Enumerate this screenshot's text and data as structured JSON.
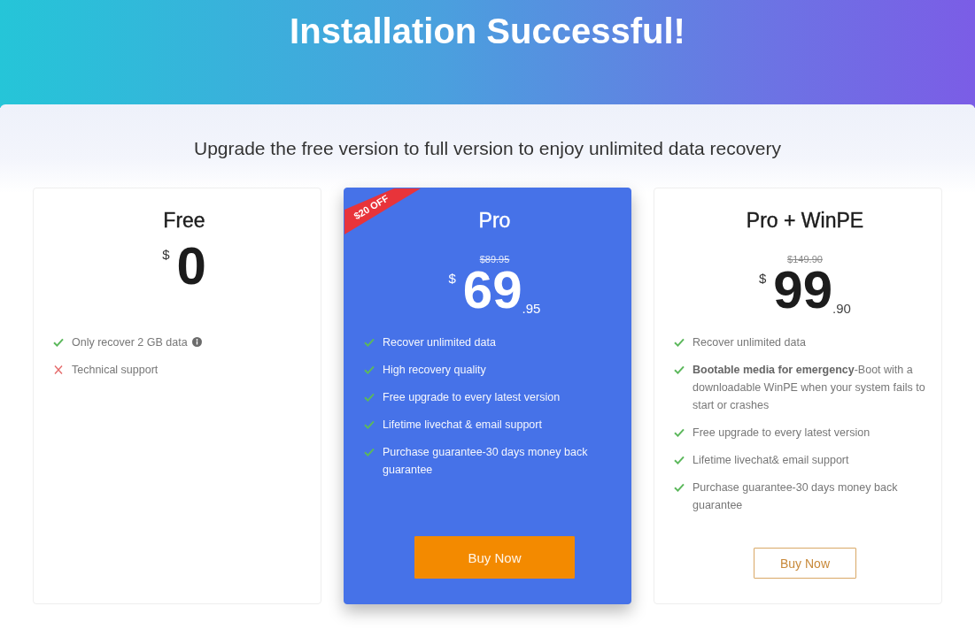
{
  "header": {
    "title": "Installation Successful!"
  },
  "subtitle": "Upgrade the free version to full version to enjoy unlimited data recovery",
  "plans": [
    {
      "name": "Free",
      "highlighted": false,
      "price": {
        "currency": "$",
        "whole": "0"
      },
      "features": [
        {
          "text": "Only recover 2 GB data",
          "included": true,
          "info": true
        },
        {
          "text": "Technical support",
          "included": false,
          "info": false
        }
      ]
    },
    {
      "name": "Pro",
      "highlighted": true,
      "badge": "$20 OFF",
      "old_price": "$89.95",
      "price": {
        "currency": "$",
        "whole": "69",
        "cents": ".95"
      },
      "features": [
        {
          "text": "Recover unlimited data",
          "included": true,
          "info": false
        },
        {
          "text": "High recovery quality",
          "included": true,
          "info": false
        },
        {
          "text": "Free upgrade to every latest version",
          "included": true,
          "info": false
        },
        {
          "text": "Lifetime livechat & email support",
          "included": true,
          "info": false
        },
        {
          "text": "Purchase guarantee-30 days money back guarantee",
          "included": true,
          "info": false
        }
      ],
      "button": "Buy Now"
    },
    {
      "name": "Pro + WinPE",
      "highlighted": false,
      "old_price": "$149.90",
      "price": {
        "currency": "$",
        "whole": "99",
        "cents": ".90"
      },
      "features": [
        {
          "text": "Recover unlimited data",
          "included": true,
          "info": false
        },
        {
          "text": "**Bootable media for emergency**-Boot with a downloadable WinPE when your system fails to start or crashes",
          "included": true,
          "info": false
        },
        {
          "text": "Free upgrade to every latest version",
          "included": true,
          "info": false
        },
        {
          "text": "Lifetime livechat& email support",
          "included": true,
          "info": false
        },
        {
          "text": "Purchase guarantee-30 days money back guarantee",
          "included": true,
          "info": false
        }
      ],
      "button": "Buy Now"
    }
  ]
}
